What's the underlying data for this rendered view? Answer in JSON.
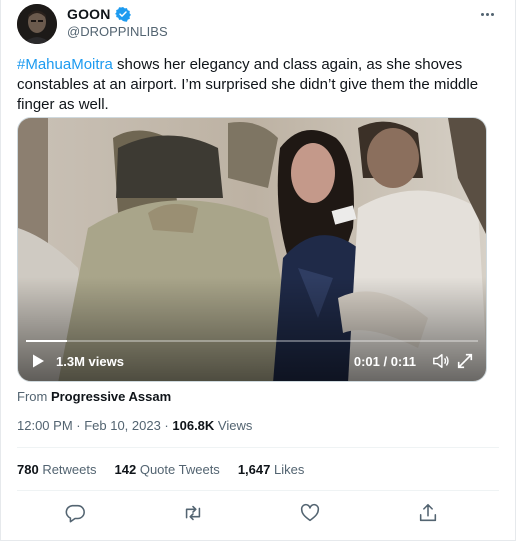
{
  "author": {
    "display_name": "GOON",
    "handle": "@DROPPINLIBS",
    "verified": true,
    "verified_color": "#1d9bf0"
  },
  "tweet": {
    "hashtag": "#MahuaMoitra",
    "text": " shows her elegancy and class again, as she shoves constables at an airport. I’m surprised she didn’t give them the middle finger as well."
  },
  "video": {
    "views": "1.3M views",
    "time": "0:01 / 0:11",
    "progress": 0.09,
    "icons": [
      "play-icon",
      "volume-icon",
      "expand-icon"
    ]
  },
  "source": {
    "prefix": "From ",
    "name": "Progressive Assam"
  },
  "meta": {
    "timestamp": "12:00 PM · Feb 10, 2023 · ",
    "views_count": "106.8K",
    "views_label": " Views"
  },
  "stats": {
    "retweets_count": "780",
    "retweets_label": " Retweets",
    "quotes_count": "142",
    "quotes_label": " Quote Tweets",
    "likes_count": "1,647",
    "likes_label": " Likes"
  },
  "actions": [
    "reply-icon",
    "retweet-icon",
    "like-icon",
    "share-icon"
  ],
  "colors": {
    "accent": "#1d9bf0",
    "secondary_text": "#536471",
    "primary_text": "#0f1419"
  }
}
